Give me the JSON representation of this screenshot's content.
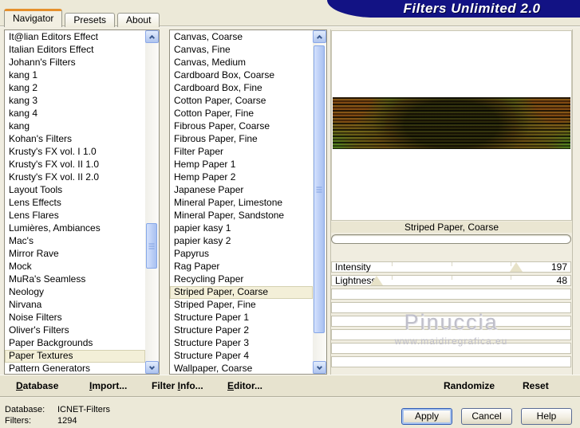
{
  "window": {
    "banner_title": "Filters Unlimited 2.0",
    "tabs": [
      {
        "label": "Navigator",
        "active": true
      },
      {
        "label": "Presets",
        "active": false
      },
      {
        "label": "About",
        "active": false
      }
    ]
  },
  "categories": {
    "selected_index": 25,
    "items": [
      "It@lian Editors Effect",
      "Italian Editors Effect",
      "Johann's Filters",
      "kang 1",
      "kang 2",
      "kang 3",
      "kang 4",
      "kang",
      "Kohan's Filters",
      "Krusty's FX vol. I 1.0",
      "Krusty's FX vol. II 1.0",
      "Krusty's FX vol. II 2.0",
      "Layout Tools",
      "Lens Effects",
      "Lens Flares",
      "Lumières, Ambiances",
      "Mac's",
      "Mirror Rave",
      "Mock",
      "MuRa's Seamless",
      "Neology",
      "Nirvana",
      "Noise Filters",
      "Oliver's Filters",
      "Paper Backgrounds",
      "Paper Textures",
      "Pattern Generators"
    ]
  },
  "filters": {
    "selected_index": 20,
    "items": [
      "Canvas, Coarse",
      "Canvas, Fine",
      "Canvas, Medium",
      "Cardboard Box, Coarse",
      "Cardboard Box, Fine",
      "Cotton Paper, Coarse",
      "Cotton Paper, Fine",
      "Fibrous Paper, Coarse",
      "Fibrous Paper, Fine",
      "Filter Paper",
      "Hemp Paper 1",
      "Hemp Paper 2",
      "Japanese Paper",
      "Mineral Paper, Limestone",
      "Mineral Paper, Sandstone",
      "papier kasy 1",
      "papier kasy 2",
      "Papyrus",
      "Rag Paper",
      "Recycling Paper",
      "Striped Paper, Coarse",
      "Striped Paper, Fine",
      "Structure Paper 1",
      "Structure Paper 2",
      "Structure Paper 3",
      "Structure Paper 4",
      "Wallpaper, Coarse"
    ]
  },
  "preview": {
    "filter_name": "Striped Paper, Coarse"
  },
  "sliders": [
    {
      "label": "Intensity",
      "value": 197,
      "max": 255
    },
    {
      "label": "Lightness",
      "value": 48,
      "max": 255
    }
  ],
  "watermark": {
    "name": "Pinuccia",
    "url": "www.maidiregrafica.eu"
  },
  "toolbar": {
    "database": {
      "key": "D",
      "rest": "atabase"
    },
    "import": {
      "key": "I",
      "rest": "mport..."
    },
    "filter_info": {
      "pre": "Filter ",
      "key": "I",
      "rest": "nfo..."
    },
    "editor": {
      "key": "E",
      "rest": "ditor..."
    },
    "randomize": "Randomize",
    "reset": "Reset"
  },
  "status": {
    "database_label": "Database:",
    "database_value": "ICNET-Filters",
    "filters_label": "Filters:",
    "filters_value": "1294"
  },
  "buttons": {
    "apply": "Apply",
    "cancel": "Cancel",
    "help": "Help"
  },
  "colors": {
    "banner_navy": "#121284",
    "tab_accent_orange": "#e5902c",
    "selection_cream": "#f3efd8",
    "scrollbar_blue": "#aec4ef",
    "window_beige": "#ece9d8"
  }
}
